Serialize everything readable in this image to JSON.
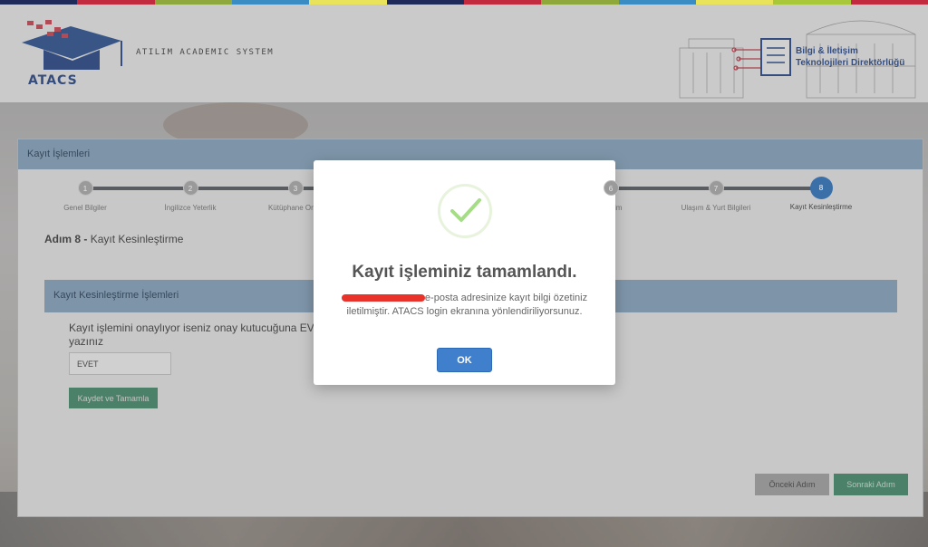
{
  "colors": {
    "stripe": [
      "#1e2a5a",
      "#c22b3f",
      "#8fa83c",
      "#3a8cc3",
      "#e9e25b",
      "#1e2a5a",
      "#c22b3f",
      "#8fa83c",
      "#3a8cc3",
      "#e9e25b",
      "#a8c83a",
      "#c22b3f"
    ],
    "panel_header": "#86a9c6",
    "success_green": "#3d8b67",
    "ok_blue": "#3f7fcc"
  },
  "header": {
    "logo_text": "ATACS",
    "system_name": "ATILIM ACADEMIC SYSTEM",
    "directorate_line1": "Bilgi & İletişim",
    "directorate_line2": "Teknolojileri Direktörlüğü"
  },
  "panel": {
    "title": "Kayıt İşlemleri",
    "steps": [
      {
        "number": "1",
        "label": "Genel Bilgiler"
      },
      {
        "number": "2",
        "label": "İngilizce Yeterlik"
      },
      {
        "number": "3",
        "label": "Kütüphane Onay"
      },
      {
        "number": "6",
        "label": "İletişim"
      },
      {
        "number": "7",
        "label": "Ulaşım & Yurt Bilgileri"
      },
      {
        "number": "8",
        "label": "Kayıt Kesinleştirme"
      }
    ],
    "step_title_prefix": "Adım 8 -",
    "step_title": "Kayıt Kesinleştirme",
    "section_title": "Kayıt Kesinleştirme İşlemleri",
    "instruction": "Kayıt işlemini onaylıyor iseniz onay kutucuğuna EVET yazınız",
    "input_value": "EVET",
    "save_button": "Kaydet ve Tamamla",
    "prev_button": "Önceki Adım",
    "next_button": "Sonraki Adım"
  },
  "modal": {
    "icon": "checkmark-icon",
    "title": "Kayıt işleminiz tamamlandı.",
    "body_line1": "e-posta adresinize kayıt bilgi özetiniz",
    "body_line2": "iletilmiştir. ATACS login ekranına yönlendiriliyorsunuz.",
    "ok_button": "OK"
  }
}
